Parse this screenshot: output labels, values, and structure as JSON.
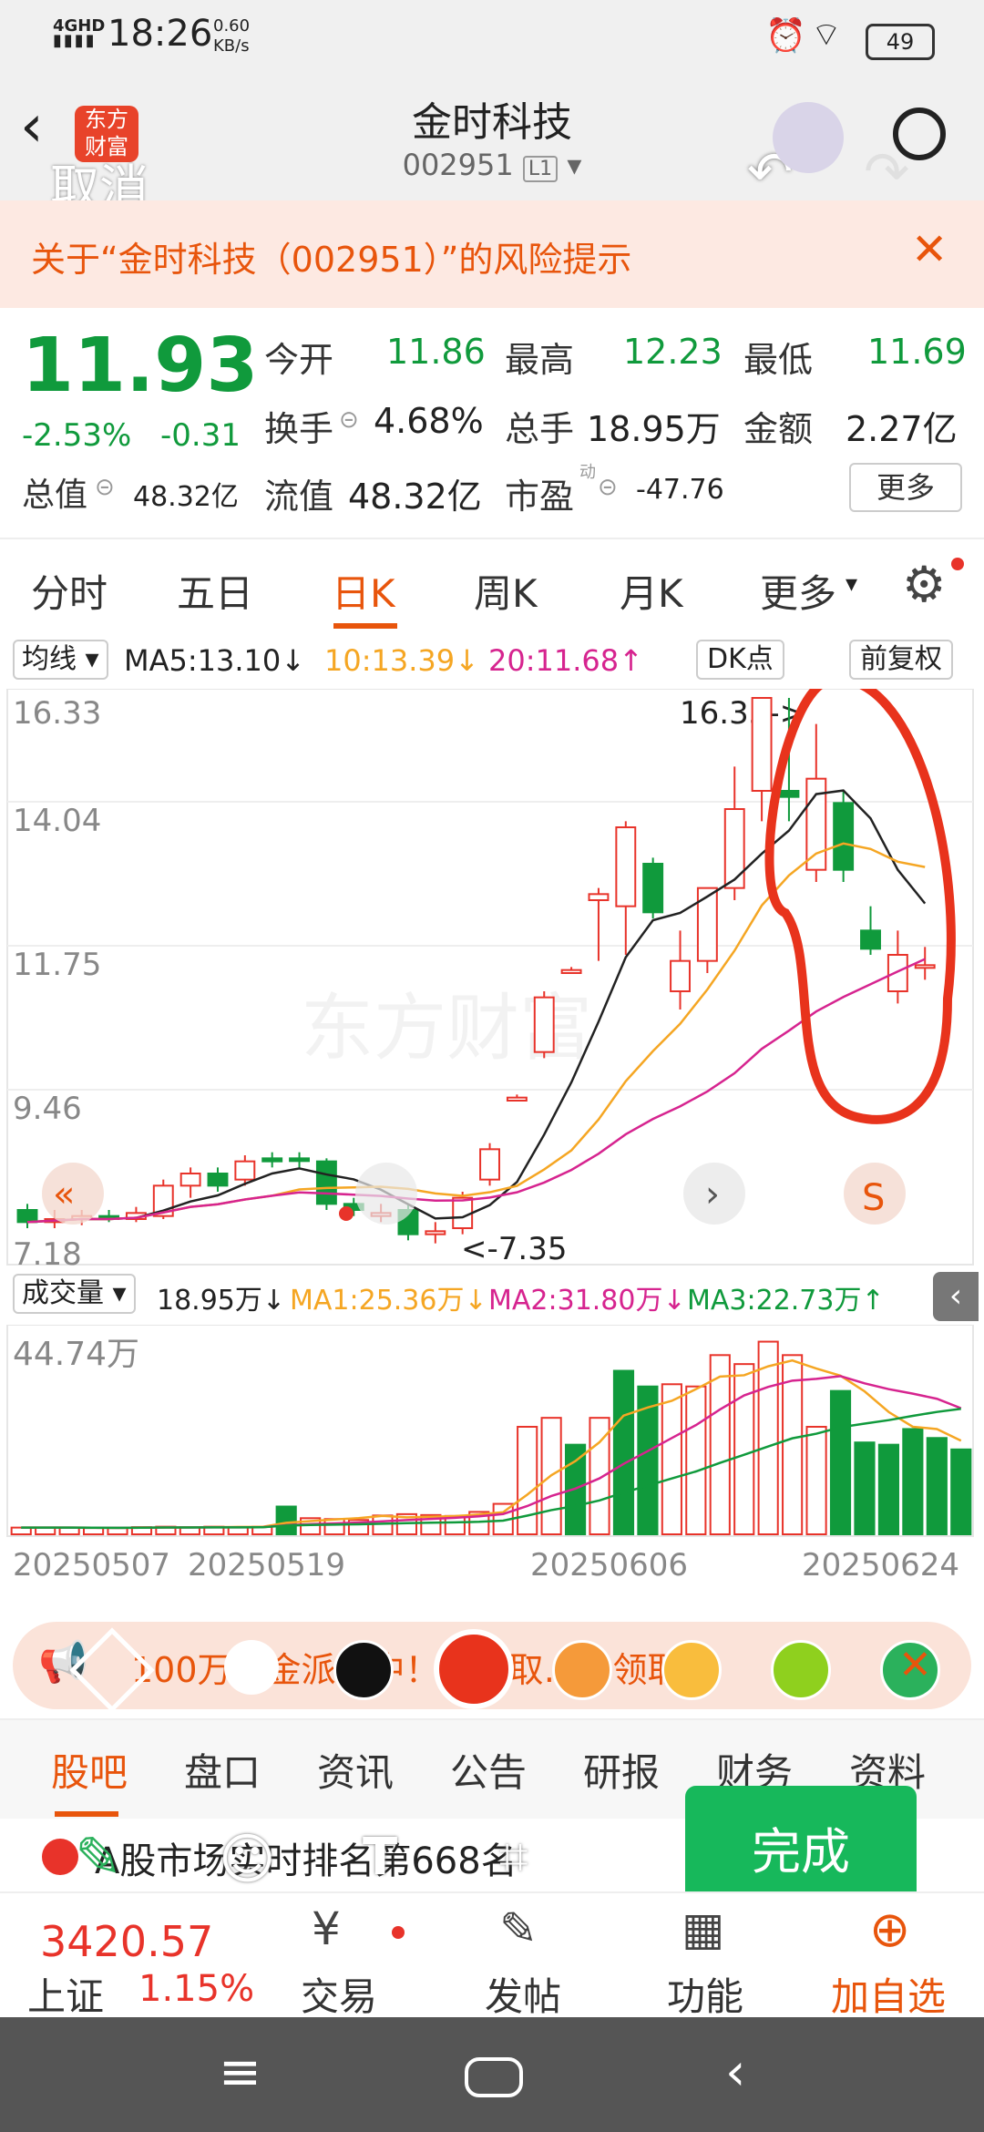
{
  "status_bar": {
    "network": "4GHD",
    "time": "18:26",
    "speed_value": "0.60",
    "speed_unit": "KB/s",
    "battery": "49"
  },
  "header": {
    "logo_text": "东方财富",
    "title": "金时科技",
    "code": "002951",
    "level": "L1",
    "cancel": "取消"
  },
  "risk_banner": {
    "text": "关于“金时科技（002951）”的风险提示"
  },
  "quote": {
    "price": "11.93",
    "change_pct": "-2.53%",
    "change_amt": "-0.31",
    "open_label": "今开",
    "open": "11.86",
    "high_label": "最高",
    "high": "12.23",
    "low_label": "最低",
    "low": "11.69",
    "turnover_label": "换手",
    "turnover": "4.68%",
    "volume_label": "总手",
    "volume": "18.95万",
    "amount_label": "金额",
    "amount": "2.27亿",
    "mcap_label": "总值",
    "mcap": "48.32亿",
    "float_label": "流值",
    "float": "48.32亿",
    "pe_label": "市盈",
    "pe_sup": "动",
    "pe": "-47.76",
    "more": "更多"
  },
  "tabs": [
    "分时",
    "五日",
    "日K",
    "周K",
    "月K",
    "更多"
  ],
  "kline_bar": {
    "ma_label": "均线",
    "ma5": "MA5:13.10↓",
    "ma10": "10:13.39↓",
    "ma20": "20:11.68↑",
    "dk": "DK点",
    "fq": "前复权"
  },
  "kline_chart": {
    "max_label": "16.33",
    "max_mark": "16.33->",
    "min_mark": "<-7.35",
    "axis_top": "16.33",
    "axis_2": "14.04",
    "axis_3": "11.75",
    "axis_4": "9.46",
    "axis_bottom": "7.18",
    "watermark": "东方财富"
  },
  "vol_bar": {
    "label": "成交量",
    "vol": "18.95万↓",
    "ma1": "MA1:25.36万↓",
    "ma2": "MA2:31.80万↓",
    "ma3": "MA3:22.73万↑",
    "axis_top": "44.74万"
  },
  "dates": [
    "20250507",
    "20250519",
    "20250606",
    "20250624"
  ],
  "notice": {
    "text": "100万现金派送中！可领取……领取"
  },
  "bottom_tabs": [
    "股吧",
    "盘口",
    "资讯",
    "公告",
    "研报",
    "财务",
    "资料"
  ],
  "news": {
    "text": "A股市场实时排名第668名"
  },
  "bottom_bar": {
    "index_value": "3420.57",
    "index_name": "上证",
    "index_pct": "1.15%",
    "trade": "交易",
    "post": "发帖",
    "func": "功能",
    "add": "加自选"
  },
  "editor": {
    "done": "完成"
  },
  "colors": {
    "up": "#e8332a",
    "down": "#109a3c",
    "ma5": "#222222",
    "ma10": "#f5a623",
    "ma20": "#d6248f",
    "annotation": "#e8331c"
  },
  "chart_data": {
    "type": "candlestick",
    "ylim": [
      7.18,
      16.33
    ],
    "candles": [
      {
        "o": 7.9,
        "c": 7.7,
        "h": 8.0,
        "l": 7.6
      },
      {
        "o": 7.7,
        "c": 7.75,
        "h": 7.9,
        "l": 7.6
      },
      {
        "o": 7.75,
        "c": 7.8,
        "h": 7.9,
        "l": 7.65
      },
      {
        "o": 7.8,
        "c": 7.75,
        "h": 7.9,
        "l": 7.7
      },
      {
        "o": 7.75,
        "c": 7.85,
        "h": 7.95,
        "l": 7.7
      },
      {
        "o": 7.8,
        "c": 8.3,
        "h": 8.4,
        "l": 7.75
      },
      {
        "o": 8.3,
        "c": 8.5,
        "h": 8.6,
        "l": 8.1
      },
      {
        "o": 8.5,
        "c": 8.3,
        "h": 8.6,
        "l": 8.2
      },
      {
        "o": 8.4,
        "c": 8.7,
        "h": 8.8,
        "l": 8.3
      },
      {
        "o": 8.75,
        "c": 8.7,
        "h": 8.85,
        "l": 8.6
      },
      {
        "o": 8.75,
        "c": 8.72,
        "h": 8.85,
        "l": 8.6
      },
      {
        "o": 8.7,
        "c": 8.0,
        "h": 8.75,
        "l": 7.9
      },
      {
        "o": 8.0,
        "c": 7.9,
        "h": 8.1,
        "l": 7.8
      },
      {
        "o": 7.8,
        "c": 7.85,
        "h": 8.0,
        "l": 7.7
      },
      {
        "o": 7.9,
        "c": 7.5,
        "h": 8.0,
        "l": 7.4
      },
      {
        "o": 7.5,
        "c": 7.55,
        "h": 7.7,
        "l": 7.35
      },
      {
        "o": 7.6,
        "c": 8.1,
        "h": 8.2,
        "l": 7.5
      },
      {
        "o": 8.4,
        "c": 8.9,
        "h": 9.0,
        "l": 8.3
      },
      {
        "o": 9.7,
        "c": 9.75,
        "h": 9.8,
        "l": 9.7
      },
      {
        "o": 10.5,
        "c": 11.4,
        "h": 11.5,
        "l": 10.4
      },
      {
        "o": 11.8,
        "c": 11.85,
        "h": 11.9,
        "l": 11.8
      },
      {
        "o": 13.0,
        "c": 13.1,
        "h": 13.2,
        "l": 12.0
      },
      {
        "o": 12.9,
        "c": 14.2,
        "h": 14.3,
        "l": 12.1
      },
      {
        "o": 13.6,
        "c": 12.8,
        "h": 13.7,
        "l": 12.7
      },
      {
        "o": 11.5,
        "c": 12.0,
        "h": 12.5,
        "l": 11.2
      },
      {
        "o": 12.0,
        "c": 13.2,
        "h": 13.2,
        "l": 11.8
      },
      {
        "o": 13.2,
        "c": 14.5,
        "h": 15.2,
        "l": 13.0
      },
      {
        "o": 14.8,
        "c": 16.33,
        "h": 16.33,
        "l": 14.3
      },
      {
        "o": 14.8,
        "c": 14.7,
        "h": 16.33,
        "l": 14.3
      },
      {
        "o": 13.5,
        "c": 15.0,
        "h": 15.9,
        "l": 13.3
      },
      {
        "o": 14.6,
        "c": 13.5,
        "h": 14.8,
        "l": 13.3
      },
      {
        "o": 12.5,
        "c": 12.2,
        "h": 12.9,
        "l": 12.1
      },
      {
        "o": 11.5,
        "c": 12.1,
        "h": 12.5,
        "l": 11.3
      },
      {
        "o": 11.93,
        "c": 11.93,
        "h": 12.23,
        "l": 11.69
      }
    ],
    "volumes": [
      1.5,
      1.5,
      1.5,
      1.4,
      1.4,
      1.6,
      1.7,
      1.6,
      1.7,
      1.6,
      1.7,
      6.2,
      3.6,
      3.4,
      3.2,
      4.2,
      4.5,
      4.3,
      4.1,
      5.0,
      6.8,
      24.0,
      26.0,
      20.0,
      26.0,
      36.5,
      33.0,
      33.5,
      33.0,
      40.0,
      38.0,
      43.0,
      40.0,
      24.0,
      32.0,
      20.5,
      20.0,
      23.5,
      21.5,
      18.95
    ]
  }
}
